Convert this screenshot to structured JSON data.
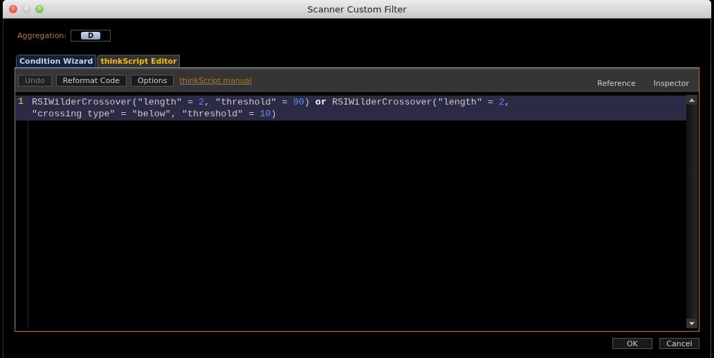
{
  "window": {
    "title": "Scanner Custom Filter"
  },
  "aggregation": {
    "label": "Aggregation:",
    "value": "D"
  },
  "tabs": [
    {
      "label": "Condition Wizard",
      "selected": false
    },
    {
      "label": "thinkScript Editor",
      "selected": true
    }
  ],
  "toolbar": {
    "buttons": [
      {
        "label": "Undo",
        "disabled": true
      },
      {
        "label": "Reformat Code",
        "disabled": false
      },
      {
        "label": "Options",
        "disabled": false
      }
    ],
    "link": "thinkScript manual",
    "right_tabs": [
      "Reference",
      "Inspector"
    ]
  },
  "editor": {
    "line_number": "1",
    "lines": [
      [
        {
          "kind": "plain",
          "text": "RSIWilderCrossover(\"length\" = "
        },
        {
          "kind": "number",
          "text": "2"
        },
        {
          "kind": "plain",
          "text": ", \"threshold\" = "
        },
        {
          "kind": "number",
          "text": "90"
        },
        {
          "kind": "plain",
          "text": ") "
        },
        {
          "kind": "keyword",
          "text": "or"
        },
        {
          "kind": "plain",
          "text": " RSIWilderCrossover(\"length\" = "
        },
        {
          "kind": "number",
          "text": "2"
        },
        {
          "kind": "plain",
          "text": ","
        }
      ],
      [
        {
          "kind": "plain",
          "text": "\"crossing type\" = \"below\", \"threshold\" = "
        },
        {
          "kind": "number",
          "text": "10"
        },
        {
          "kind": "plain",
          "text": ")"
        }
      ]
    ]
  },
  "buttons": [
    "OK",
    "Cancel"
  ]
}
